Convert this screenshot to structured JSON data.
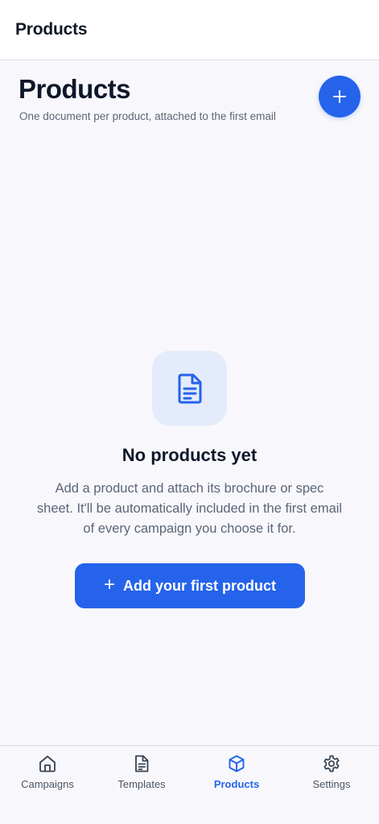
{
  "topbar": {
    "title": "Products"
  },
  "header": {
    "title": "Products",
    "subtitle": "One document per product, attached to the first email",
    "add_button_symbol": "+",
    "add_button_icon": "plus-icon"
  },
  "empty_state": {
    "icon": "document-icon",
    "title": "No products yet",
    "description": "Add a product and attach its brochure or spec sheet. It'll be automatically included in the first email of every campaign you choose it for.",
    "cta_symbol": "+",
    "cta_label": "Add your first product"
  },
  "bottom_nav": {
    "items": [
      {
        "label": "Campaigns",
        "icon": "home-icon",
        "active": false
      },
      {
        "label": "Templates",
        "icon": "document-icon",
        "active": false
      },
      {
        "label": "Products",
        "icon": "box-icon",
        "active": true
      },
      {
        "label": "Settings",
        "icon": "gear-icon",
        "active": false
      }
    ]
  },
  "colors": {
    "accent": "#2563eb",
    "background": "#f8f8fc",
    "icon_tile": "#e4ecfb",
    "muted_text": "#5b6577"
  }
}
